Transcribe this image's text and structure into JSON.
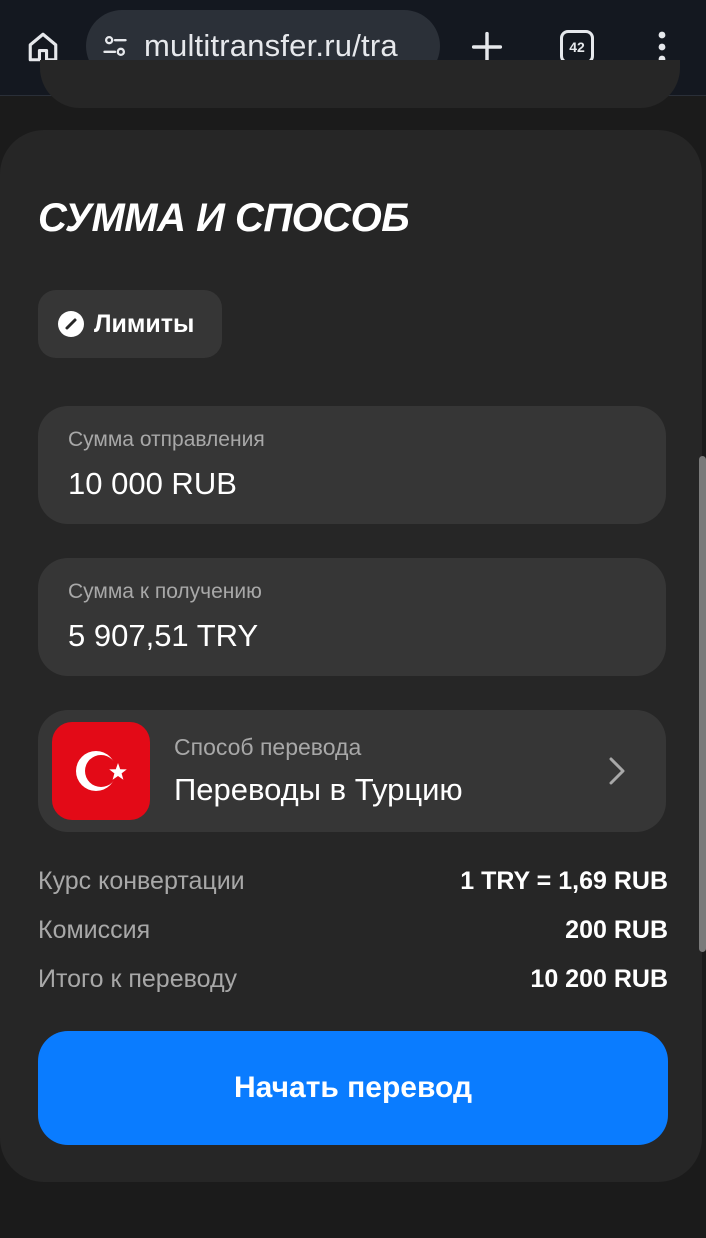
{
  "browser": {
    "url": "multitransfer.ru/tra",
    "tab_count": "42"
  },
  "section": {
    "title": "СУММА И СПОСОБ",
    "limits_label": "Лимиты"
  },
  "send": {
    "label": "Сумма отправления",
    "value": "10 000 RUB"
  },
  "receive": {
    "label": "Сумма к получению",
    "value": "5 907,51 TRY"
  },
  "method": {
    "label": "Способ перевода",
    "value": "Переводы в Турцию",
    "flag_color": "#e30a17"
  },
  "info": {
    "rate_label": "Курс конвертации",
    "rate_value": "1 TRY = 1,69 RUB",
    "fee_label": "Комиссия",
    "fee_value": "200 RUB",
    "total_label": "Итого к переводу",
    "total_value": "10 200 RUB"
  },
  "actions": {
    "start_label": "Начать перевод",
    "start_color": "#0a7cff"
  },
  "icons": {
    "home": "home-icon",
    "site_settings": "tune-icon",
    "new_tab": "plus-icon",
    "tabs": "tab-count-icon",
    "menu": "more-vert-icon",
    "limits": "gauge-icon",
    "chevron": "chevron-right-icon"
  }
}
